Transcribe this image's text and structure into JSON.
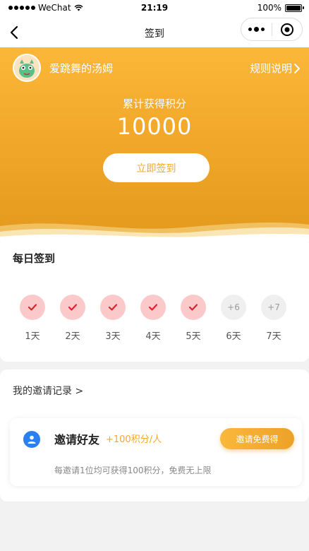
{
  "status_bar": {
    "carrier": "WeChat",
    "time": "21:19",
    "battery_text": "100%",
    "battery_level": 1.0
  },
  "nav": {
    "title": "签到"
  },
  "hero": {
    "user_name": "爱跳舞的汤姆",
    "rules_label": "规则说明",
    "points_label": "累计获得积分",
    "points_value": "10000",
    "signin_label": "立即签到",
    "colors": {
      "accent": "#f2a82a",
      "gradient_top": "#fbb739",
      "gradient_bottom": "#e39a1c"
    }
  },
  "daily": {
    "title": "每日签到",
    "days": [
      {
        "label": "1天",
        "status": "done",
        "mark": ""
      },
      {
        "label": "2天",
        "status": "done",
        "mark": ""
      },
      {
        "label": "3天",
        "status": "done",
        "mark": ""
      },
      {
        "label": "4天",
        "status": "done",
        "mark": ""
      },
      {
        "label": "5天",
        "status": "done",
        "mark": ""
      },
      {
        "label": "6天",
        "status": "todo",
        "mark": "+6"
      },
      {
        "label": "7天",
        "status": "todo",
        "mark": "+7"
      }
    ],
    "colors": {
      "done_bg": "#fcc9cb",
      "check": "#e0202b"
    }
  },
  "invite": {
    "record_label": "我的邀请记录 >",
    "title": "邀请好友",
    "bonus": "+100积分/人",
    "button_label": "邀请免费得",
    "description": "每邀请1位均可获得100积分，免费无上限"
  }
}
